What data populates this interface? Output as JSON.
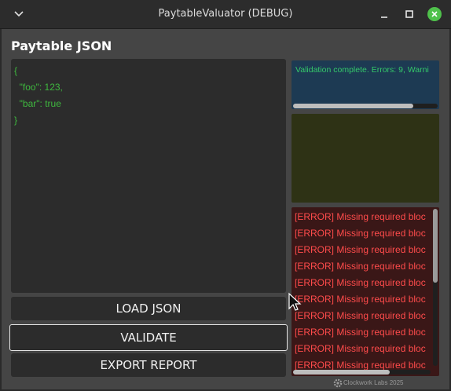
{
  "window": {
    "title": "PaytableValuator (DEBUG)",
    "icons": {
      "menu": "chevron-down-icon",
      "minimize": "minimize-icon",
      "maximize": "maximize-icon",
      "close": "close-icon"
    },
    "close_color": "#4fc14b"
  },
  "main": {
    "heading": "Paytable JSON",
    "json_lines": [
      "{",
      "  \"foo\": 123,",
      "  \"bar\": true",
      "}"
    ],
    "json_text_color": "#3fb83f"
  },
  "buttons": {
    "load": "LOAD JSON",
    "validate": "VALIDATE",
    "export": "EXPORT REPORT"
  },
  "summary": {
    "text": "Validation complete. Errors: 9, Warni",
    "color": "#34c86a",
    "scroll_fraction": 0.83
  },
  "errors": {
    "lines": [
      "[ERROR] Missing required bloc",
      "[ERROR] Missing required bloc",
      "[ERROR] Missing required bloc",
      "[ERROR] Missing required bloc",
      "[ERROR] Missing required bloc",
      "[ERROR] Missing required bloc",
      "[ERROR] Missing required bloc",
      "[ERROR] Missing required bloc",
      "[ERROR] Missing required bloc",
      "[ERROR] Missing required bloc"
    ],
    "color": "#ff4b4b",
    "h_scroll_fraction": 0.7,
    "v_scroll_fraction": 0.47
  },
  "footer": {
    "text": "Clockwork Labs 2025",
    "icon": "gear-icon"
  }
}
